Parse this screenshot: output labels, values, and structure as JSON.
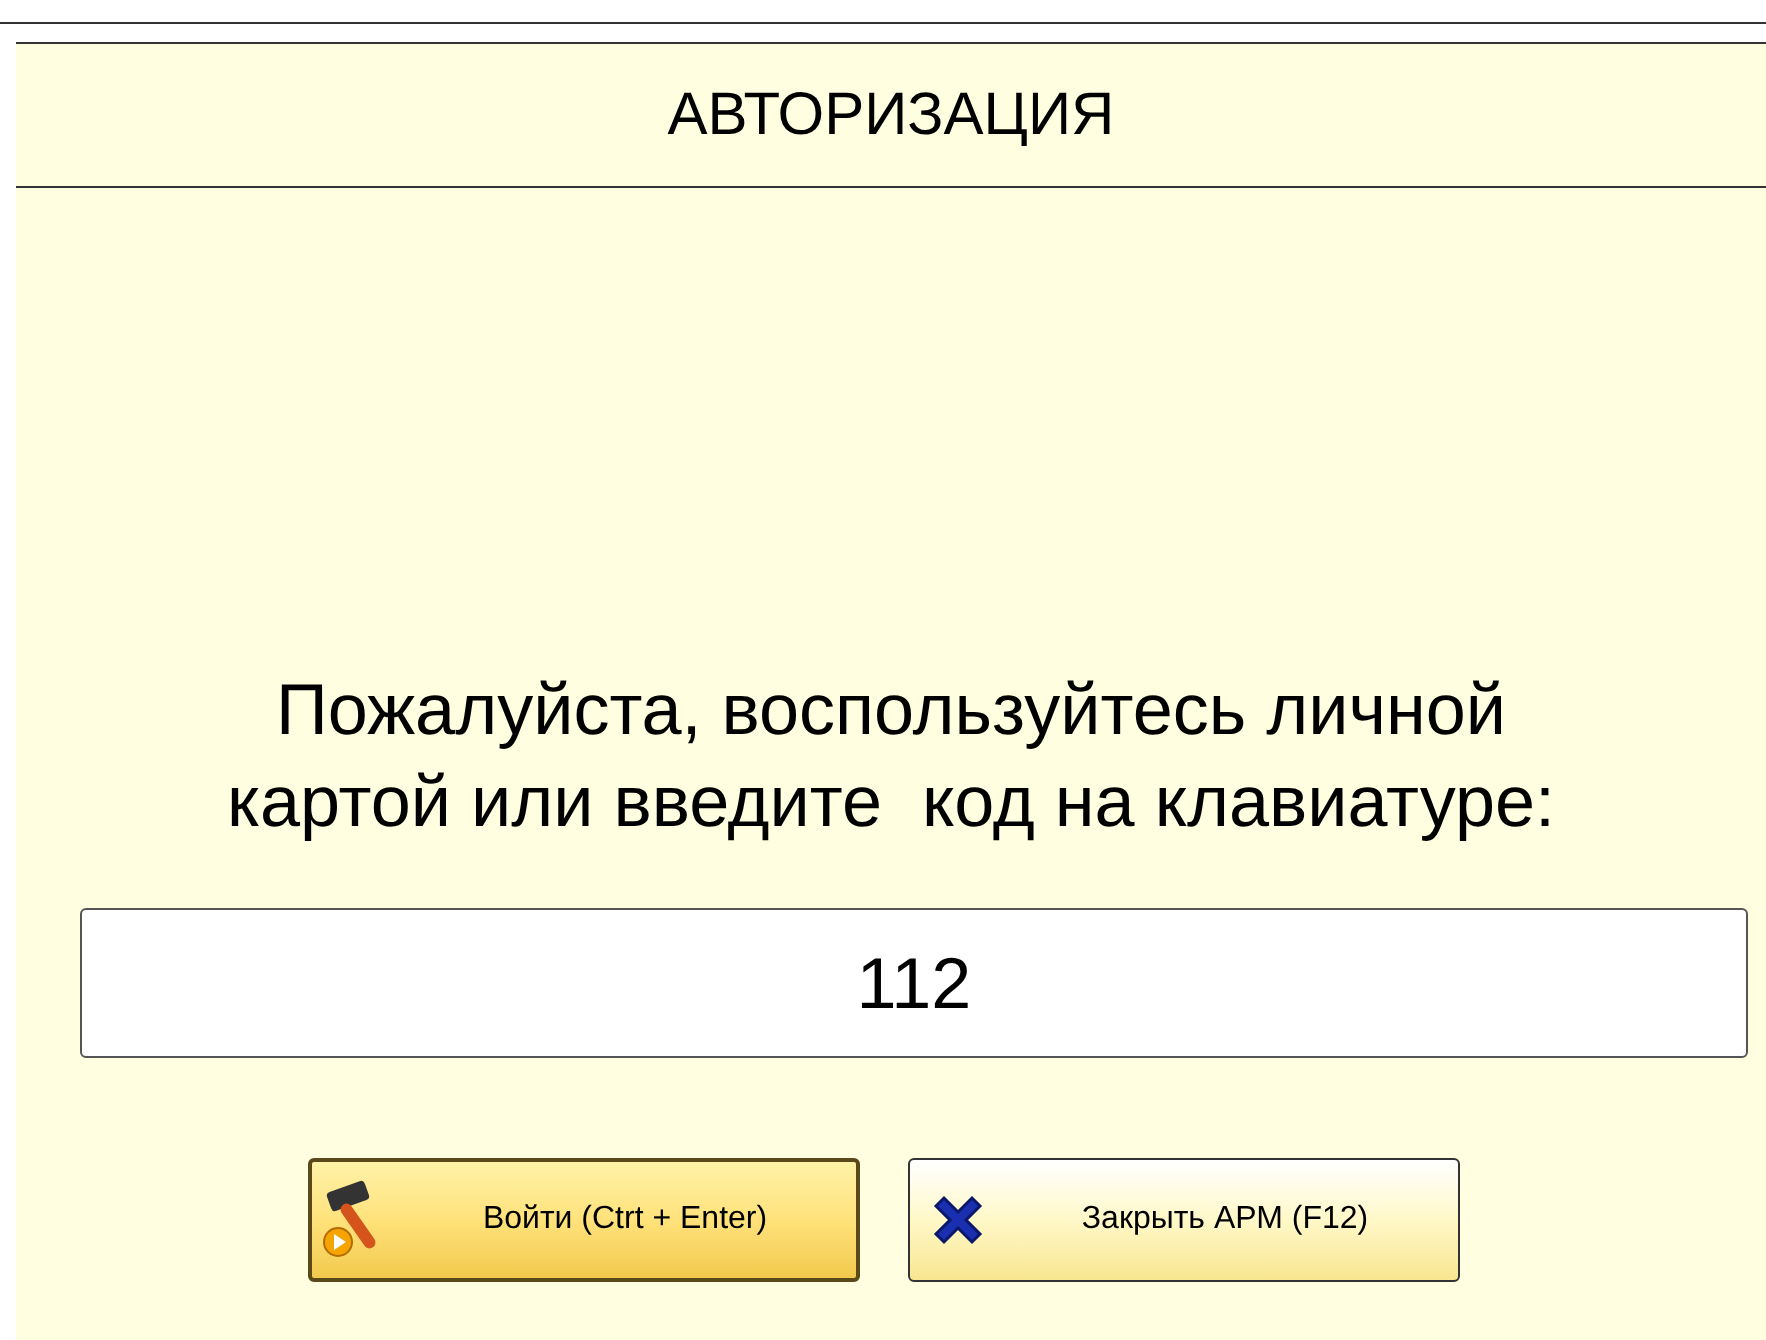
{
  "header": {
    "title": "АВТОРИЗАЦИЯ"
  },
  "prompt": {
    "lines": [
      "Пожалуйста, воспользуйтесь личной",
      "картой или введите  код на клавиатуре:"
    ]
  },
  "code_field": {
    "value": "112"
  },
  "buttons": [
    {
      "label": "Войти (Ctrt + Enter)",
      "kind": "login",
      "focused": true
    },
    {
      "label": "Закрыть АРМ (F12)",
      "kind": "close",
      "focused": false
    }
  ]
}
